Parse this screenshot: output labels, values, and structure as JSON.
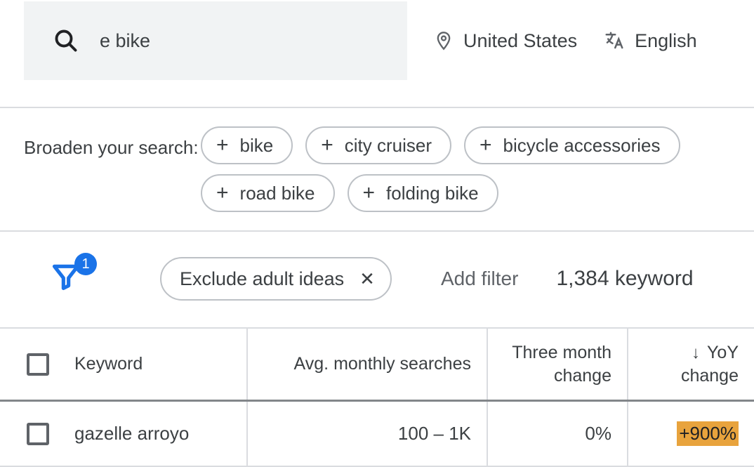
{
  "search": {
    "value": "e bike"
  },
  "location": {
    "label": "United States"
  },
  "language": {
    "label": "English"
  },
  "broaden": {
    "label": "Broaden your search:",
    "chips": [
      "bike",
      "city cruiser",
      "bicycle accessories",
      "road bike",
      "folding bike"
    ]
  },
  "filters": {
    "badge": "1",
    "active": {
      "label": "Exclude adult ideas"
    },
    "add_label": "Add filter",
    "count_label": "1,384 keyword"
  },
  "table": {
    "headers": {
      "keyword": "Keyword",
      "avg": "Avg. monthly searches",
      "three_month": "Three month change",
      "yoy": "YoY change"
    },
    "rows": [
      {
        "keyword": "gazelle arroyo",
        "avg": "100 – 1K",
        "three_month": "0%",
        "yoy": "+900%"
      }
    ]
  }
}
